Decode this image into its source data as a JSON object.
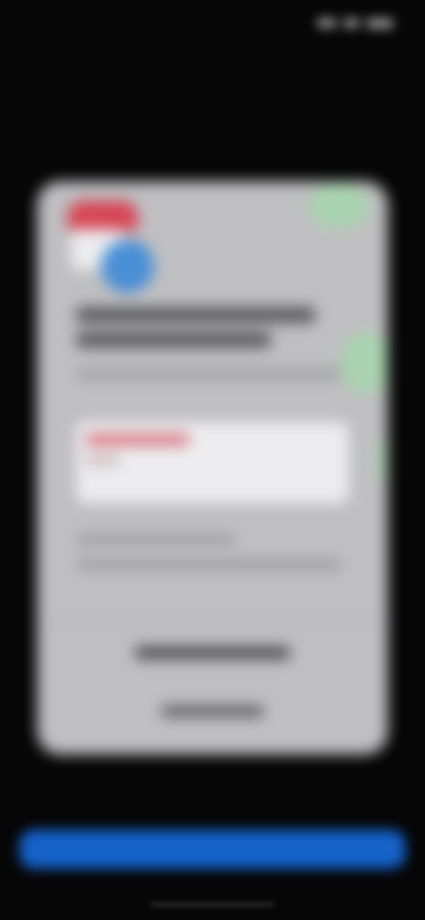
{
  "status_bar": {
    "time": "",
    "icons": [
      "signal-icon",
      "wifi-icon",
      "battery-icon"
    ]
  },
  "header": {
    "title": ""
  },
  "card": {
    "logo": "app-logo",
    "heading": "",
    "description": "",
    "preview_panel": {
      "highlight_text": "",
      "detail_text": ""
    },
    "body_text": "",
    "primary_action_label": "",
    "secondary_action_label": ""
  },
  "bottom_button": {
    "label": "",
    "color": "#1562c9"
  },
  "colors": {
    "background": "#060607",
    "card": "#bfbfc1",
    "accent_green": "#a9d3b0",
    "logo_red": "#d64555",
    "logo_blue": "#4a8fd6"
  }
}
